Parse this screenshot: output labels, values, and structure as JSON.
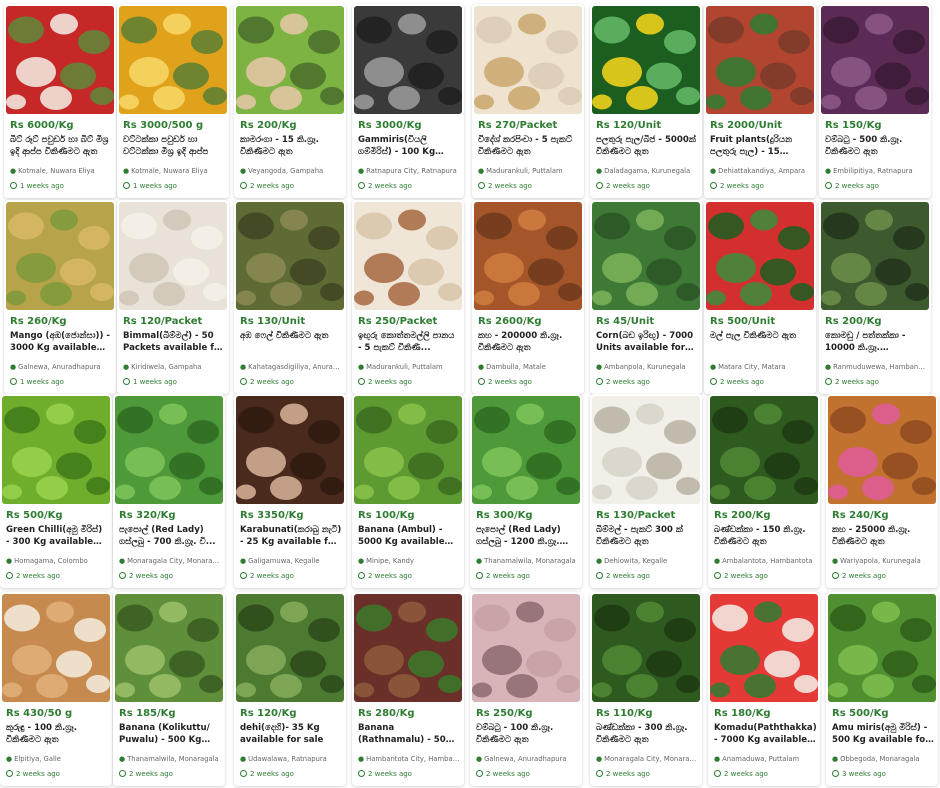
{
  "listings": [
    {
      "price": "Rs 6000/Kg",
      "title": "බීට් රූට් පවුඩර් හා බීට් මිශ්‍ර ඉදි ආප්ප විකිණීමට ඇත",
      "location": "Kotmale, Nuwara Eliya",
      "time": "1 weeks ago",
      "icon": "beetroot-powder-jars-image",
      "colors": [
        "#c62828",
        "#f5f0e6",
        "#5d8a3a"
      ]
    },
    {
      "price": "Rs 3000/500 g",
      "title": "වට්ටක්කා පවුඩර් හා වට්ටක්කා මිශ්‍ර ඉදි ආප්ප",
      "location": "Kotmale, Nuwara Eliya",
      "time": "1 weeks ago",
      "icon": "pumpkin-powder-packets-image",
      "colors": [
        "#e0a21a",
        "#f7d96a",
        "#5b7f33"
      ]
    },
    {
      "price": "Rs 200/Kg",
      "title": "කාමරංගා - 15 කි.ග්‍රෑ. විකිණීමට ඇත",
      "location": "Veyangoda, Gampaha",
      "time": "2 weeks ago",
      "icon": "star-fruit-image",
      "colors": [
        "#7cb342",
        "#e8c7a8",
        "#4a6d2a"
      ]
    },
    {
      "price": "Rs 3000/Kg",
      "title": "Gammiris(වියලි ගම්මිරිස්) - 100 Kg available",
      "location": "Ratnapura City, Ratnapura",
      "time": "2 weeks ago",
      "icon": "pepper-seeds-image",
      "colors": [
        "#3a3a3a",
        "#9e9e9e",
        "#202020"
      ]
    },
    {
      "price": "Rs 270/Packet",
      "title": "විදේශ් කරපිංචා - 5 පැකට් විකිණීමට ඇත",
      "location": "Madurankuli, Puttalam",
      "time": "2 weeks ago",
      "icon": "packet-image",
      "colors": [
        "#efe3cf",
        "#c9a66b",
        "#d9cbb5"
      ]
    },
    {
      "price": "Rs 120/Unit",
      "title": "පලතුරු පැල/බීජ - 5000ක් විකිණීමට ඇත",
      "location": "Daladagama, Kurunegala",
      "time": "2 weeks ago",
      "icon": "plants-flyer-image",
      "colors": [
        "#1b5e20",
        "#f9d71c",
        "#66bb6a"
      ]
    },
    {
      "price": "Rs 2000/Unit",
      "title": "Fruit plants(දුරියන පලතුරු පැල) - 15 Unit...",
      "location": "Dehiattakandiya, Ampara",
      "time": "2 weeks ago",
      "icon": "plant-in-hand-image",
      "colors": [
        "#b2452f",
        "#2e7d32",
        "#7a3b2c"
      ]
    },
    {
      "price": "Rs 150/Kg",
      "title": "වම්බටු - 500 කි.ග්‍රෑ. විකිණීමට ඇත",
      "location": "Embilipitiya, Ratnapura",
      "time": "2 weeks ago",
      "icon": "brinjal-image",
      "colors": [
        "#5b2a55",
        "#8e5a86",
        "#3a1a36"
      ]
    },
    {
      "price": "Rs 260/Kg",
      "title": "Mango (අඹ(ජොන්සා)) - 3000 Kg available for sale",
      "location": "Galnewa, Anuradhapura",
      "time": "1 weeks ago",
      "icon": "mango-image",
      "colors": [
        "#b7a34a",
        "#7e9a3c",
        "#d9b865"
      ]
    },
    {
      "price": "Rs 120/Packet",
      "title": "Bimmal(බිම්මල්) - 50 Packets available for sale",
      "location": "Kiridiwela, Gampaha",
      "time": "1 weeks ago",
      "icon": "mushroom-packets-image",
      "colors": [
        "#e8e2d8",
        "#cfc6b6",
        "#f5f1ea"
      ]
    },
    {
      "price": "Rs 130/Unit",
      "title": "අඹ ෆෙල් විකිණීමට ඇත",
      "location": "Kahatagasdigiliya, Anuradh...",
      "time": "2 weeks ago",
      "icon": "fruit-pile-image",
      "colors": [
        "#5f6b34",
        "#8c8a55",
        "#3f4423"
      ]
    },
    {
      "price": "Rs 250/Packet",
      "title": "ඉඟුරු කොත්තමල්ලි පානය - 5 පැකට් විකිණී...",
      "location": "Madurankuli, Puttalam",
      "time": "2 weeks ago",
      "icon": "drink-packet-image",
      "colors": [
        "#efe6d8",
        "#a5673f",
        "#d7c4a8"
      ]
    },
    {
      "price": "Rs 2600/Kg",
      "title": "කහ - 200000 කි.ග්‍රෑ. විකිණීමට ඇත",
      "location": "Dambulla, Matale",
      "time": "2 weeks ago",
      "icon": "turmeric-image",
      "colors": [
        "#a4562a",
        "#d07c3e",
        "#6e3a1c"
      ]
    },
    {
      "price": "Rs 45/Unit",
      "title": "Corn(බඩ ඉරිඟු) - 7000 Units available for sale",
      "location": "Ambanpola, Kurunegala",
      "time": "2 weeks ago",
      "icon": "corn-field-image",
      "colors": [
        "#3e7a35",
        "#7fb35a",
        "#2a5524"
      ]
    },
    {
      "price": "Rs 500/Unit",
      "title": "මල් පැල විකිණීමට ඇත",
      "location": "Matara City, Matara",
      "time": "2 weeks ago",
      "icon": "flowers-image",
      "colors": [
        "#d32f2f",
        "#388e3c",
        "#1b5e20"
      ]
    },
    {
      "price": "Rs 200/Kg",
      "title": "කොමඩු / පත්තක්කා - 10000 කි.ග්‍රෑ. විකිණීමට...",
      "location": "Ranmuduwewa, Hambantota",
      "time": "2 weeks ago",
      "icon": "melon-image",
      "colors": [
        "#3c5a2e",
        "#6b8f4a",
        "#22331a"
      ]
    },
    {
      "price": "Rs 500/Kg",
      "title": "Green Chilli(අමු මිරිස්) - 300 Kg available for sale",
      "location": "Homagama, Colombo",
      "time": "2 weeks ago",
      "icon": "green-chilli-image",
      "colors": [
        "#6fae2d",
        "#9bd34e",
        "#3f7a1a"
      ]
    },
    {
      "price": "Rs 320/Kg",
      "title": "පැපොල් (Red Lady) ගස්ලබු - 700 කි.ග්‍රෑ. වි...",
      "location": "Monaragala City, Monaragala",
      "time": "2 weeks ago",
      "icon": "papaya-image",
      "colors": [
        "#4e9a3a",
        "#7fc45a",
        "#2f6b22"
      ]
    },
    {
      "price": "Rs 3350/Kg",
      "title": "Karabunati(කරාබු නැටි) - 25 Kg available for sale",
      "location": "Galigamuwa, Kegalle",
      "time": "2 weeks ago",
      "icon": "cloves-image",
      "colors": [
        "#4a2a1c",
        "#d8b49a",
        "#2e1a10"
      ]
    },
    {
      "price": "Rs 100/Kg",
      "title": "Banana (Ambul) - 5000 Kg available for sale",
      "location": "Minipe, Kandy",
      "time": "2 weeks ago",
      "icon": "banana-bunches-image",
      "colors": [
        "#5d9a32",
        "#8bc34a",
        "#3b6b1f"
      ]
    },
    {
      "price": "Rs 300/Kg",
      "title": "පැපොල් (Red Lady) ගස්ලබු - 1200 කි.ග්‍රෑ. වි...",
      "location": "Thanamalwila, Monaragala",
      "time": "2 weeks ago",
      "icon": "papaya-image",
      "colors": [
        "#4e9a3a",
        "#7fc45a",
        "#2f6b22"
      ]
    },
    {
      "price": "Rs 130/Packet",
      "title": "බිම්මල් - පැකට් 300 ක් විකිණීමට ඇත",
      "location": "Dehiowita, Kegalle",
      "time": "2 weeks ago",
      "icon": "mushrooms-image",
      "colors": [
        "#f2efe9",
        "#d8d2c7",
        "#b9b1a3"
      ]
    },
    {
      "price": "Rs 200/Kg",
      "title": "බණ්ඩක්කා - 150 කි.ග්‍රෑ. විකිණීමට ඇත",
      "location": "Ambalantota, Hambantota",
      "time": "2 weeks ago",
      "icon": "okra-image",
      "colors": [
        "#2f5a1f",
        "#4f8a35",
        "#1d3a12"
      ]
    },
    {
      "price": "Rs 240/Kg",
      "title": "කහ - 25000 කි.ග්‍රෑ. විකිණීමට ඇත",
      "location": "Wariyapola, Kurunegala",
      "time": "2 weeks ago",
      "icon": "turmeric-sack-image",
      "colors": [
        "#c2722f",
        "#e05a9a",
        "#8e4a1e"
      ]
    },
    {
      "price": "Rs 430/50 g",
      "title": "කුරුඳු - 100 කි.ග්‍රෑ. විකිණීමට ඇත",
      "location": "Elpitiya, Galle",
      "time": "2 weeks ago",
      "icon": "cinnamon-image",
      "colors": [
        "#c68a4e",
        "#e0b07a",
        "#f4ede2"
      ]
    },
    {
      "price": "Rs 185/Kg",
      "title": "Banana (Kolikuttu/ Puwalu) - 500 Kg availa...",
      "location": "Thanamalwila, Monaragala",
      "time": "2 weeks ago",
      "icon": "banana-tree-image",
      "colors": [
        "#5f8f3a",
        "#9cc26a",
        "#3a5c22"
      ]
    },
    {
      "price": "Rs 120/Kg",
      "title": "dehi(දෙහි)- 35 Kg available for sale",
      "location": "Udawalawa, Ratnapura",
      "time": "2 weeks ago",
      "icon": "lime-tree-image",
      "colors": [
        "#4c7a30",
        "#86ad5a",
        "#2c4a1a"
      ]
    },
    {
      "price": "Rs 280/Kg",
      "title": "Banana (Rathnamalu) - 500 Kg available for sale",
      "location": "Hambantota City, Hambant...",
      "time": "2 weeks ago",
      "icon": "red-banana-image",
      "colors": [
        "#6b2f2a",
        "#8e5a3a",
        "#3a7a2a"
      ]
    },
    {
      "price": "Rs 250/Kg",
      "title": "වම්බටු - 100 කි.ග්‍රෑ. විකිණීමට ඇත",
      "location": "Galnewa, Anuradhapura",
      "time": "2 weeks ago",
      "icon": "sprouts-image",
      "colors": [
        "#d8b4b8",
        "#8c6a6e",
        "#c8a0a6"
      ]
    },
    {
      "price": "Rs 110/Kg",
      "title": "බණ්ඩක්කා - 300 කි.ග්‍රෑ. විකිණීමට ඇත",
      "location": "Monaragala City, Monaragala",
      "time": "2 weeks ago",
      "icon": "okra-image",
      "colors": [
        "#2f5a1f",
        "#4f8a35",
        "#1d3a12"
      ]
    },
    {
      "price": "Rs 180/Kg",
      "title": "Komadu(Paththakka) - 7000 Kg available for sale",
      "location": "Anamaduwa, Puttalam",
      "time": "2 weeks ago",
      "icon": "watermelon-image",
      "colors": [
        "#e53935",
        "#2e7d32",
        "#f4f1ea"
      ]
    },
    {
      "price": "Rs 500/Kg",
      "title": "Amu miris(අමු මිරිස්) - 500 Kg available for sale",
      "location": "Obbegoda, Monaragala",
      "time": "3 weeks ago",
      "icon": "chilli-pile-image",
      "colors": [
        "#4f8f2f",
        "#7fbf4f",
        "#2e5e1a"
      ]
    }
  ]
}
